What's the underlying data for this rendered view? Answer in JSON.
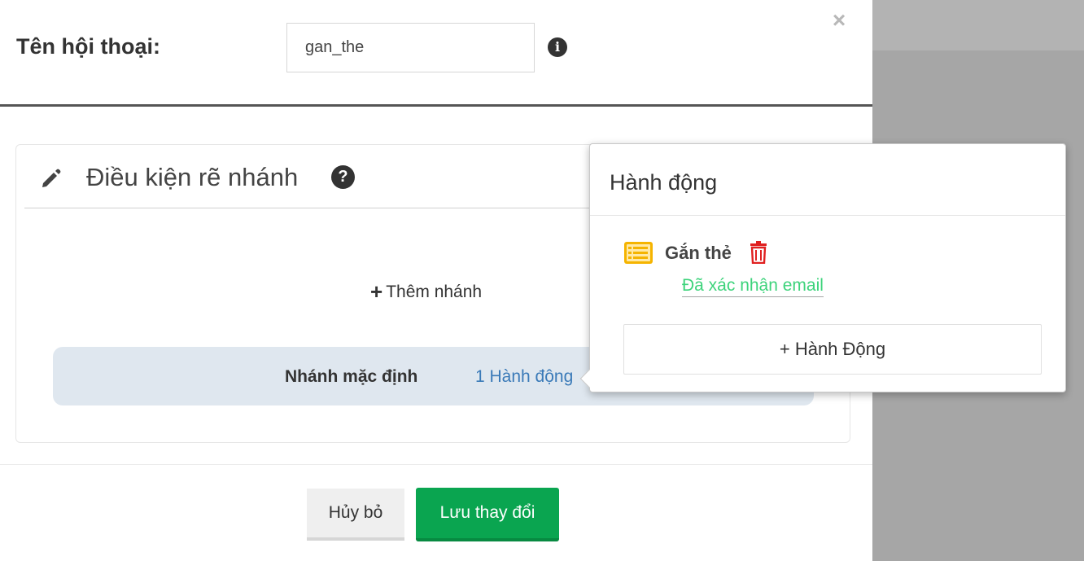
{
  "dialog": {
    "close_symbol": "×",
    "name_label": "Tên hội thoại:",
    "name_value": "gan_the",
    "info_icon": "i"
  },
  "branch_panel": {
    "title": "Điều kiện rẽ nhánh",
    "help_icon": "?",
    "add_branch_plus": "+",
    "add_branch_label": "Thêm nhánh",
    "default_branch_label": "Nhánh mặc định",
    "default_branch_actions": "1 Hành động"
  },
  "footer": {
    "cancel_label": "Hủy bỏ",
    "save_label": "Lưu thay đổi"
  },
  "popover": {
    "title": "Hành động",
    "action": {
      "name": "Gắn thẻ",
      "value": "Đã xác nhận email",
      "icon": "tag-list-icon",
      "icon_color": "#f5b400",
      "delete_color": "#e02020"
    },
    "add_action_label": "+ Hành Động"
  },
  "colors": {
    "save_button": "#0aa550",
    "link": "#3a7ab8",
    "value_text": "#3dd37b",
    "default_branch_bg": "#dfe7ef",
    "backdrop": "#a6a6a6"
  }
}
